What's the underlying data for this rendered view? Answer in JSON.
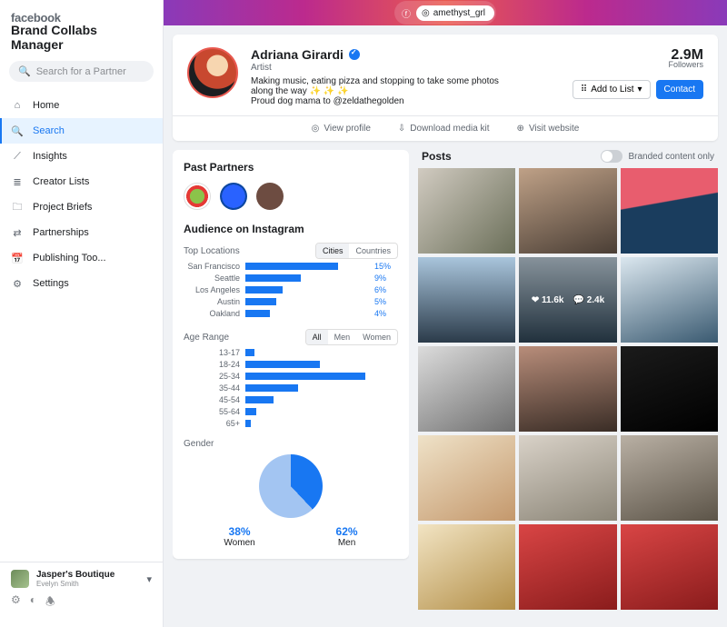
{
  "brand": {
    "fb": "facebook",
    "bcm": "Brand Collabs Manager"
  },
  "search": {
    "placeholder": "Search for a Partner"
  },
  "nav": [
    {
      "icon": "⌂",
      "label": "Home"
    },
    {
      "icon": "🔍",
      "label": "Search",
      "active": true
    },
    {
      "icon": "⟋",
      "label": "Insights"
    },
    {
      "icon": "≣",
      "label": "Creator Lists"
    },
    {
      "icon": "🗀",
      "label": "Project Briefs"
    },
    {
      "icon": "⇄",
      "label": "Partnerships"
    },
    {
      "icon": "📅",
      "label": "Publishing Too..."
    },
    {
      "icon": "⚙",
      "label": "Settings"
    }
  ],
  "account": {
    "name": "Jasper's Boutique",
    "sub": "Evelyn Smith"
  },
  "handle": {
    "ig": "amethyst_grl"
  },
  "profile": {
    "name": "Adriana Girardi",
    "role": "Artist",
    "bio": "Making music, eating pizza and stopping to take some photos along the way ✨ ✨ ✨",
    "bio2": "Proud dog mama to @zeldathegolden",
    "followers": "2.9M",
    "followers_label": "Followers",
    "addlist": "Add to List",
    "contact": "Contact",
    "actions": {
      "view": "View profile",
      "download": "Download media kit",
      "visit": "Visit website"
    }
  },
  "partners_title": "Past Partners",
  "audience_title": "Audience on Instagram",
  "locations": {
    "label": "Top Locations",
    "segments": [
      "Cities",
      "Countries"
    ],
    "rows": [
      {
        "name": "San Francisco",
        "pct": 15
      },
      {
        "name": "Seattle",
        "pct": 9
      },
      {
        "name": "Los Angeles",
        "pct": 6
      },
      {
        "name": "Austin",
        "pct": 5
      },
      {
        "name": "Oakland",
        "pct": 4
      }
    ]
  },
  "age": {
    "label": "Age Range",
    "segments": [
      "All",
      "Men",
      "Women"
    ],
    "rows": [
      {
        "name": "13-17",
        "pct": 5
      },
      {
        "name": "18-24",
        "pct": 42
      },
      {
        "name": "25-34",
        "pct": 68
      },
      {
        "name": "35-44",
        "pct": 30
      },
      {
        "name": "45-54",
        "pct": 16
      },
      {
        "name": "55-64",
        "pct": 6
      },
      {
        "name": "65+",
        "pct": 3
      }
    ]
  },
  "gender": {
    "label": "Gender",
    "women": 38,
    "men": 62,
    "women_lbl": "Women",
    "men_lbl": "Men"
  },
  "posts": {
    "title": "Posts",
    "toggle": "Branded content only",
    "overlay": {
      "likes": "11.6k",
      "comments": "2.4k"
    }
  },
  "chart_data": [
    {
      "type": "bar",
      "title": "Top Locations",
      "categories": [
        "San Francisco",
        "Seattle",
        "Los Angeles",
        "Austin",
        "Oakland"
      ],
      "values": [
        15,
        9,
        6,
        5,
        4
      ],
      "xlabel": "%",
      "orientation": "horizontal"
    },
    {
      "type": "bar",
      "title": "Age Range",
      "categories": [
        "13-17",
        "18-24",
        "25-34",
        "35-44",
        "45-54",
        "55-64",
        "65+"
      ],
      "values": [
        5,
        42,
        68,
        30,
        16,
        6,
        3
      ],
      "xlabel": "%",
      "orientation": "horizontal"
    },
    {
      "type": "pie",
      "title": "Gender",
      "series": [
        {
          "name": "Women",
          "value": 38
        },
        {
          "name": "Men",
          "value": 62
        }
      ]
    }
  ]
}
